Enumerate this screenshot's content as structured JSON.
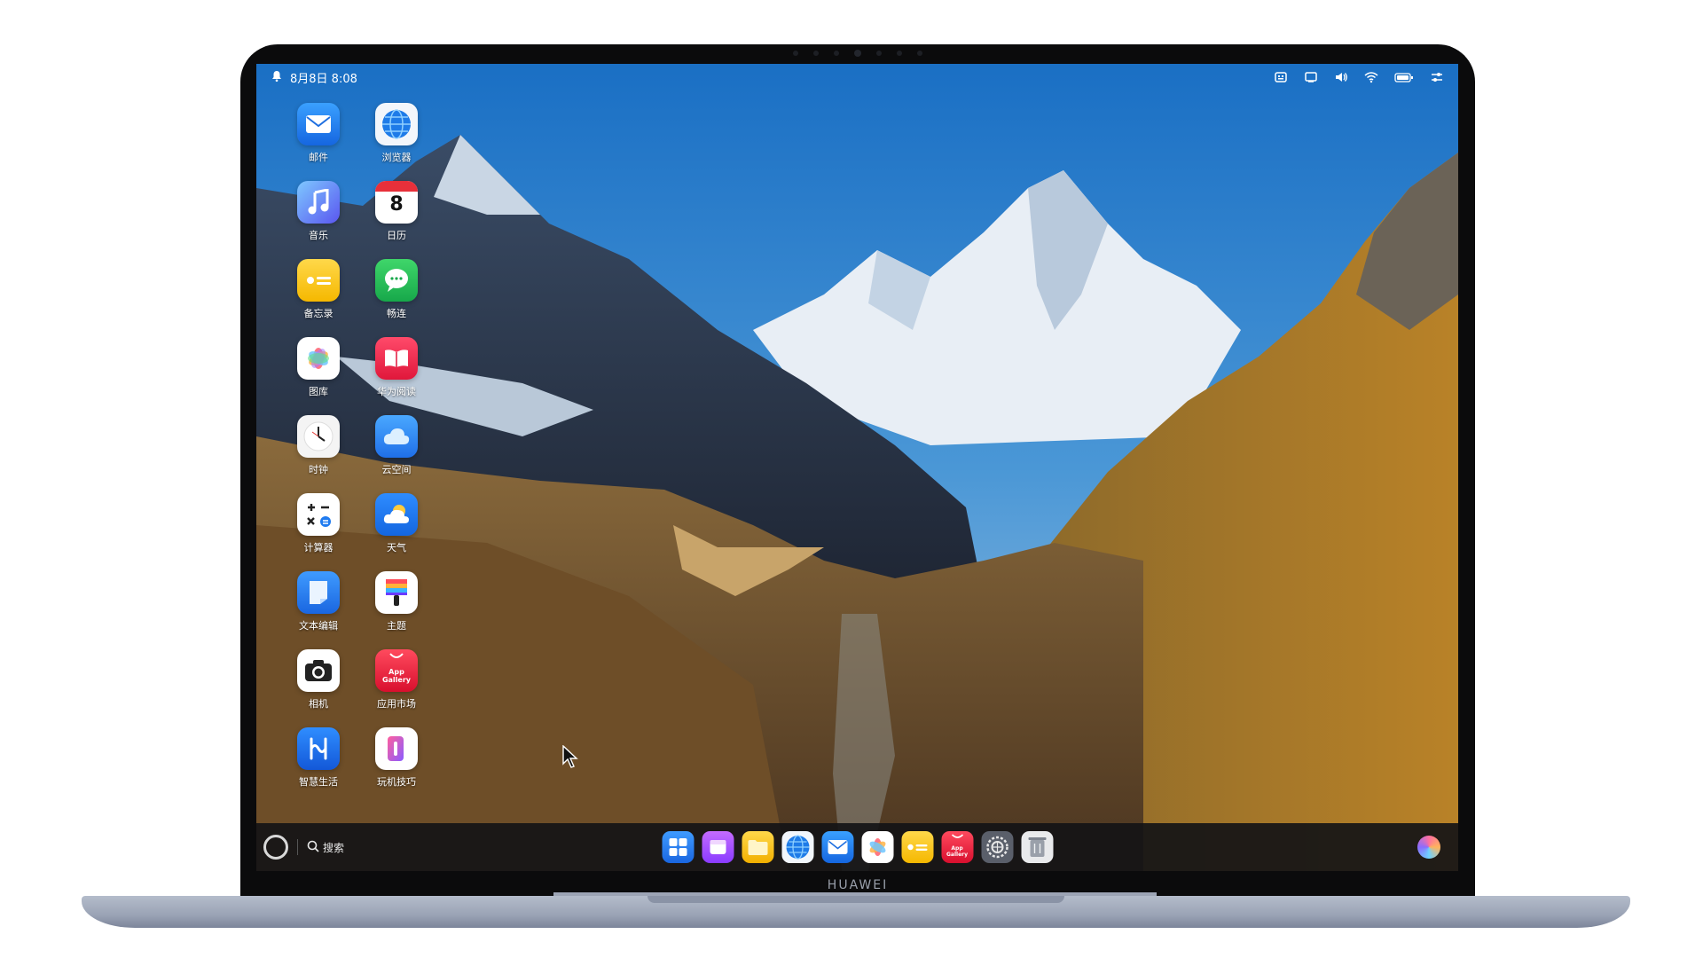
{
  "status_bar": {
    "datetime": "8月8日 8:08"
  },
  "desktop_apps": [
    {
      "label": "邮件",
      "icon": "mail-icon"
    },
    {
      "label": "浏览器",
      "icon": "browser-icon"
    },
    {
      "label": "音乐",
      "icon": "music-icon"
    },
    {
      "label": "日历",
      "icon": "calendar-icon",
      "badge": "8"
    },
    {
      "label": "备忘录",
      "icon": "notes-icon"
    },
    {
      "label": "畅连",
      "icon": "chat-icon"
    },
    {
      "label": "图库",
      "icon": "gallery-icon"
    },
    {
      "label": "华为阅读",
      "icon": "reading-icon"
    },
    {
      "label": "时钟",
      "icon": "clock-icon"
    },
    {
      "label": "云空间",
      "icon": "cloud-icon"
    },
    {
      "label": "计算器",
      "icon": "calculator-icon"
    },
    {
      "label": "天气",
      "icon": "weather-icon"
    },
    {
      "label": "文本编辑",
      "icon": "text-editor-icon"
    },
    {
      "label": "主题",
      "icon": "themes-icon"
    },
    {
      "label": "相机",
      "icon": "camera-icon"
    },
    {
      "label": "应用市场",
      "icon": "app-gallery-icon",
      "inner_text": "App Gallery"
    },
    {
      "label": "智慧生活",
      "icon": "smart-life-icon"
    },
    {
      "label": "玩机技巧",
      "icon": "tips-icon"
    }
  ],
  "dock": {
    "search_label": "搜索",
    "apps": [
      "app-grid-icon",
      "files-icon",
      "folder-icon",
      "browser-icon",
      "mail-icon",
      "gallery-icon",
      "notes-icon",
      "app-gallery-icon",
      "settings-icon",
      "trash-icon"
    ],
    "app_gallery_text": "App Gallery"
  },
  "brand": "HUAWEI",
  "colors": {
    "sky": "#2c7fcf",
    "dock_bg": "#141416",
    "lid": "#0b0b0c",
    "base": "#9aa3b5"
  }
}
